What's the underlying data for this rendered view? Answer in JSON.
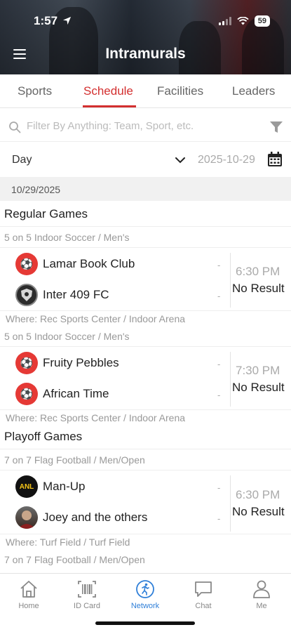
{
  "status": {
    "time": "1:57",
    "battery": "59"
  },
  "header": {
    "title": "Intramurals"
  },
  "tabs": [
    {
      "label": "Sports"
    },
    {
      "label": "Schedule",
      "active": true
    },
    {
      "label": "Facilities"
    },
    {
      "label": "Leaders"
    }
  ],
  "filter": {
    "placeholder": "Filter By Anything: Team, Sport, etc."
  },
  "view": {
    "period": "Day",
    "date": "2025-10-29"
  },
  "date_header": "10/29/2025",
  "sections": [
    {
      "title": "Regular Games",
      "games": [
        {
          "sport": "5 on 5 Indoor Soccer / Men's",
          "home": {
            "name": "Lamar Book Club",
            "score": "-",
            "logo": "red-logo"
          },
          "away": {
            "name": "Inter 409 FC",
            "score": "-",
            "logo": "crest-logo"
          },
          "time": "6:30 PM",
          "result": "No Result",
          "where": "Where: Rec Sports Center / Indoor Arena"
        },
        {
          "sport": "5 on 5 Indoor Soccer / Men's",
          "home": {
            "name": "Fruity Pebbles",
            "score": "-",
            "logo": "red-logo"
          },
          "away": {
            "name": "African Time",
            "score": "-",
            "logo": "red-logo"
          },
          "time": "7:30 PM",
          "result": "No Result",
          "where": "Where: Rec Sports Center / Indoor Arena"
        }
      ]
    },
    {
      "title": "Playoff Games",
      "games": [
        {
          "sport": "7 on 7 Flag Football / Men/Open",
          "home": {
            "name": "Man-Up",
            "score": "-",
            "logo": "anl-logo",
            "logo_text": "ANL"
          },
          "away": {
            "name": "Joey and the others",
            "score": "-",
            "logo": "photo-logo"
          },
          "time": "6:30 PM",
          "result": "No Result",
          "where": "Where: Turf Field / Turf Field"
        },
        {
          "sport": "7 on 7 Flag Football / Men/Open"
        }
      ]
    }
  ],
  "bottom_nav": [
    {
      "label": "Home",
      "icon": "home-icon"
    },
    {
      "label": "ID Card",
      "icon": "barcode-icon"
    },
    {
      "label": "Network",
      "icon": "network-icon",
      "active": true
    },
    {
      "label": "Chat",
      "icon": "chat-icon"
    },
    {
      "label": "Me",
      "icon": "person-icon"
    }
  ],
  "colors": {
    "accent": "#d32f2f",
    "nav_active": "#2f7fd8"
  }
}
